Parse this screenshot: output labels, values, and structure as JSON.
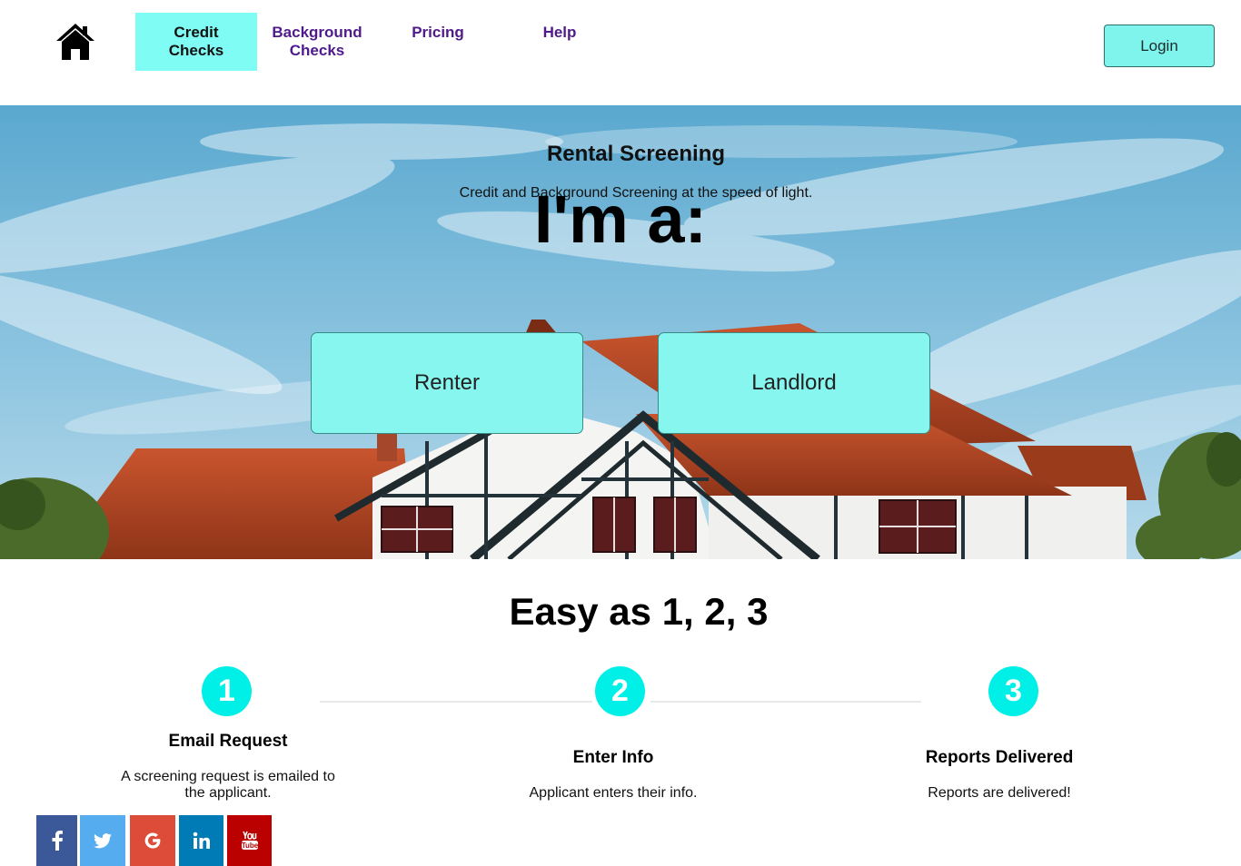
{
  "header": {
    "home_icon": "home-icon",
    "nav": [
      {
        "label_line1": "Credit",
        "label_line2": "Checks",
        "active": true
      },
      {
        "label_line1": "Background",
        "label_line2": "Checks",
        "active": false
      },
      {
        "label_line1": "Pricing",
        "label_line2": "",
        "active": false
      },
      {
        "label_line1": "Help",
        "label_line2": "",
        "active": false
      }
    ],
    "login_label": "Login"
  },
  "hero": {
    "title": "Rental Screening",
    "subtitle": "Credit and Background Screening at the speed of light.",
    "question": "I'm a:",
    "options": [
      {
        "label": "Renter"
      },
      {
        "label": "Landlord"
      }
    ]
  },
  "steps": {
    "heading": "Easy as 1, 2, 3",
    "items": [
      {
        "number": "1",
        "title": "Email Request",
        "desc_line1": "A screening request is emailed to",
        "desc_line2": "the applicant."
      },
      {
        "number": "2",
        "title": "Enter Info",
        "desc_line1": "Applicant enters their info.",
        "desc_line2": ""
      },
      {
        "number": "3",
        "title": "Reports Delivered",
        "desc_line1": "Reports are delivered!",
        "desc_line2": ""
      }
    ]
  },
  "social": [
    {
      "name": "facebook-icon",
      "color": "#3b5998"
    },
    {
      "name": "twitter-icon",
      "color": "#55acee"
    },
    {
      "name": "google-icon",
      "color": "#dd4b39"
    },
    {
      "name": "linkedin-icon",
      "color": "#007bb5"
    },
    {
      "name": "youtube-icon",
      "color": "#bb0000"
    }
  ],
  "colors": {
    "accent": "#7ffcf3",
    "nav_text": "#4f1a8c",
    "step_circle": "#00f0e8"
  }
}
